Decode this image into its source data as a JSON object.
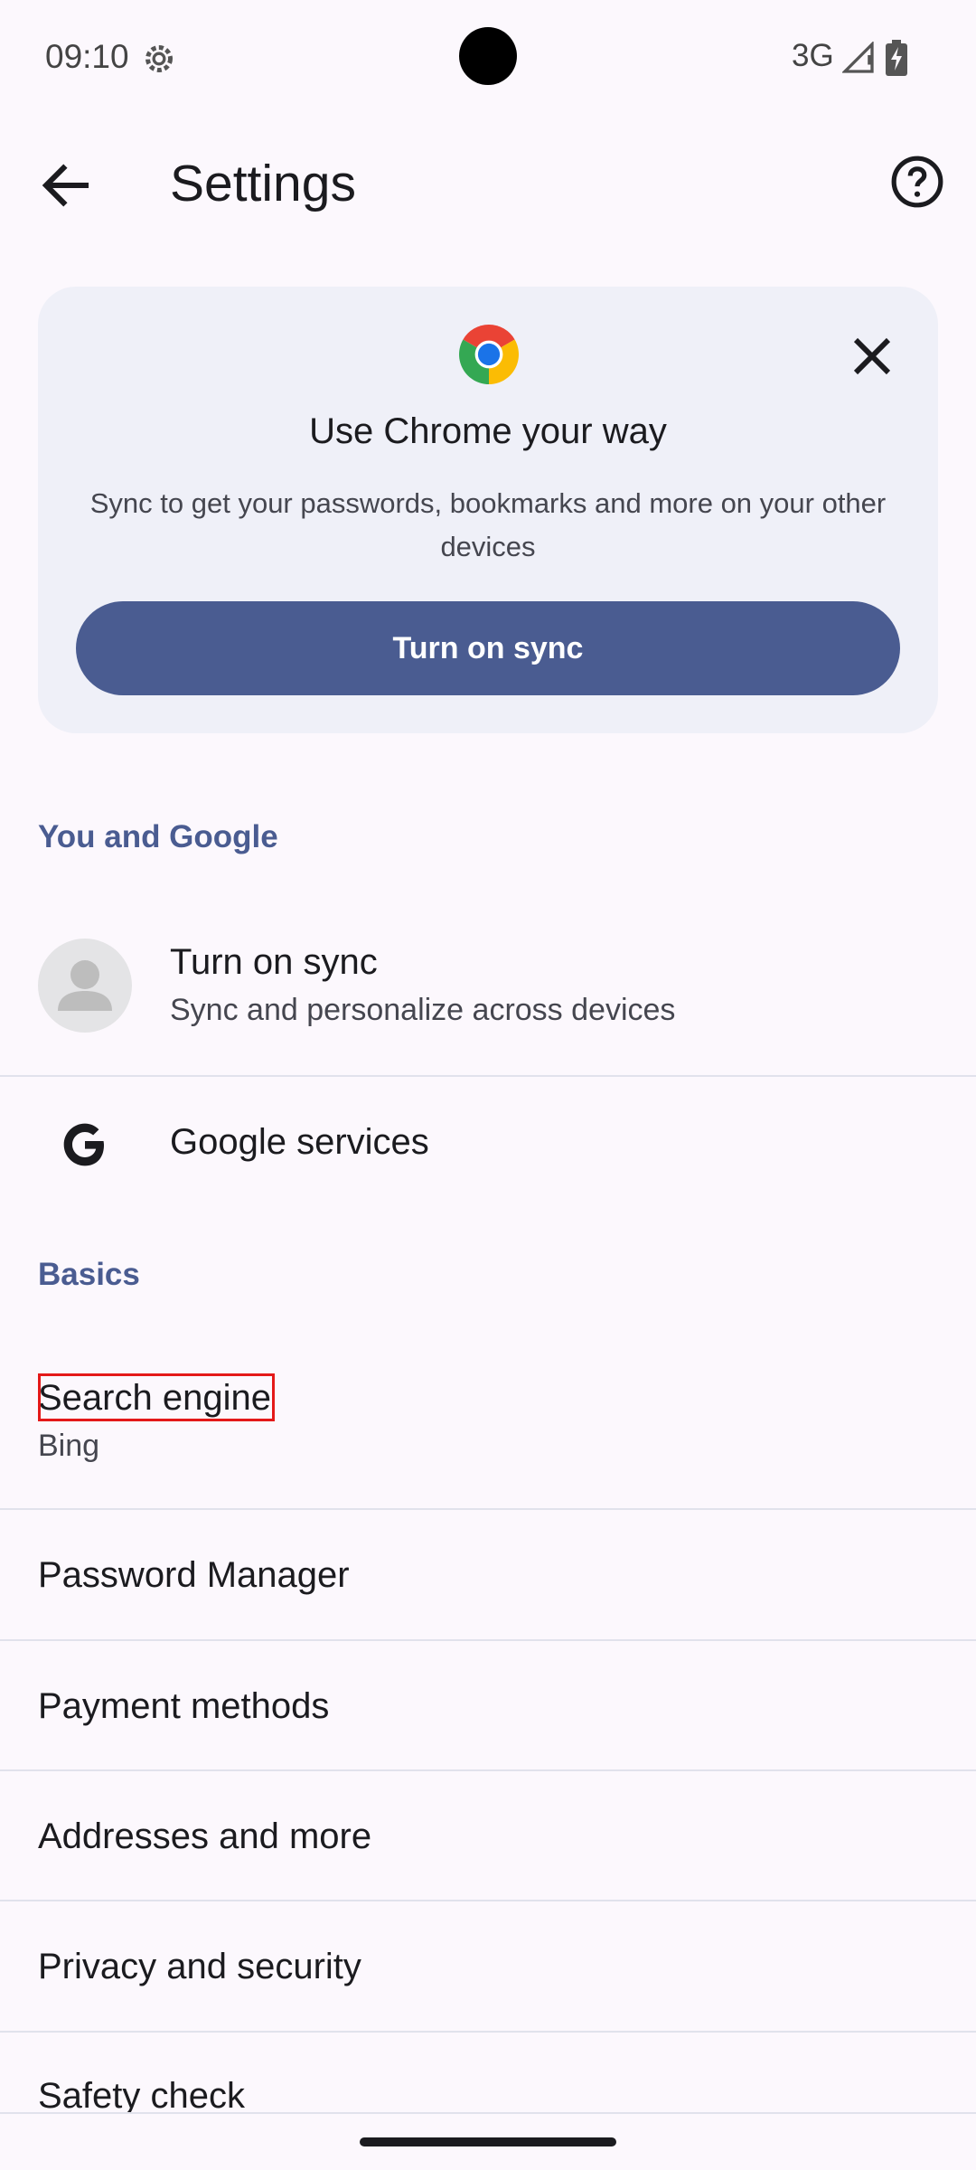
{
  "status_bar": {
    "time": "09:10",
    "network": "3G"
  },
  "header": {
    "title": "Settings"
  },
  "promo": {
    "title": "Use Chrome your way",
    "body": "Sync to get your passwords, bookmarks and more on your other devices",
    "button_label": "Turn on sync"
  },
  "sections": {
    "you_and_google": "You and Google",
    "basics": "Basics"
  },
  "you_and_google_items": [
    {
      "title": "Turn on sync",
      "subtitle": "Sync and personalize across devices"
    },
    {
      "title": "Google services"
    }
  ],
  "basics_items": [
    {
      "title": "Search engine",
      "subtitle": "Bing"
    },
    {
      "title": "Password Manager"
    },
    {
      "title": "Payment methods"
    },
    {
      "title": "Addresses and more"
    },
    {
      "title": "Privacy and security"
    },
    {
      "title": "Safety check"
    }
  ],
  "colors": {
    "accent": "#4a5c91",
    "background": "#fcf8fd",
    "card": "#eff0f8",
    "highlight": "#e41919"
  }
}
